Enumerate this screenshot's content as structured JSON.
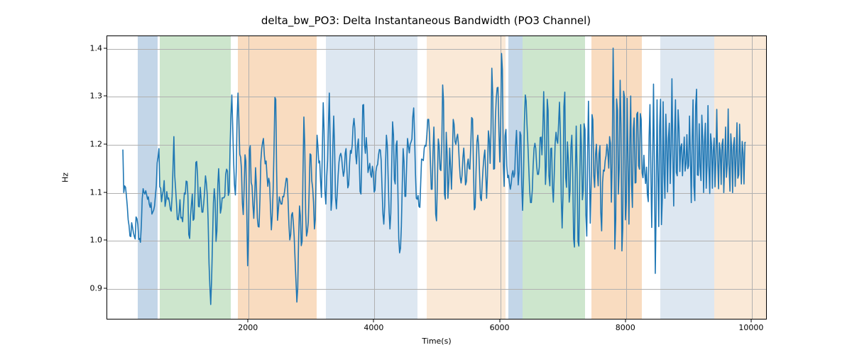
{
  "chart_data": {
    "type": "line",
    "title": "delta_bw_PO3: Delta Instantaneous Bandwidth (PO3 Channel)",
    "xlabel": "Time(s)",
    "ylabel": "Hz",
    "xlim": [
      -250,
      10250
    ],
    "ylim": [
      0.835,
      1.426
    ],
    "x_ticks": [
      2000,
      4000,
      6000,
      8000,
      10000
    ],
    "y_ticks": [
      0.9,
      1.0,
      1.1,
      1.2,
      1.3,
      1.4
    ],
    "bands": [
      {
        "start": 230,
        "end": 550,
        "color": "#c3d6e8"
      },
      {
        "start": 590,
        "end": 1710,
        "color": "#cde6cd"
      },
      {
        "start": 1830,
        "end": 3080,
        "color": "#f9dcc0"
      },
      {
        "start": 3230,
        "end": 4680,
        "color": "#dde7f1"
      },
      {
        "start": 4830,
        "end": 6080,
        "color": "#fae9d7"
      },
      {
        "start": 6130,
        "end": 6350,
        "color": "#c3d6e8"
      },
      {
        "start": 6350,
        "end": 7350,
        "color": "#cde6cd"
      },
      {
        "start": 7450,
        "end": 8250,
        "color": "#f9dcc0"
      },
      {
        "start": 8550,
        "end": 9400,
        "color": "#dde7f1"
      },
      {
        "start": 9400,
        "end": 10250,
        "color": "#fae9d7"
      }
    ],
    "series": [
      {
        "name": "delta_bw_PO3",
        "color": "#1f77b4",
        "x_start": 0,
        "x_step": 14,
        "values": [
          1.189,
          1.099,
          1.113,
          1.11,
          1.092,
          1.071,
          1.042,
          1.03,
          1.008,
          1.007,
          1.036,
          1.026,
          1.015,
          1.007,
          1.002,
          1.048,
          1.044,
          1.032,
          1.001,
          1.003,
          0.995,
          1.031,
          1.086,
          1.107,
          1.099,
          1.096,
          1.103,
          1.095,
          1.085,
          1.09,
          1.075,
          1.068,
          1.078,
          1.054,
          1.058,
          1.062,
          1.071,
          1.092,
          1.114,
          1.161,
          1.173,
          1.191,
          1.111,
          1.108,
          1.08,
          1.094,
          1.103,
          1.124,
          1.07,
          1.082,
          1.101,
          1.085,
          1.088,
          1.078,
          1.064,
          1.06,
          1.091,
          1.149,
          1.216,
          1.134,
          1.108,
          1.076,
          1.043,
          1.042,
          1.057,
          1.084,
          1.046,
          1.047,
          1.038,
          1.071,
          1.098,
          1.096,
          1.123,
          1.122,
          1.093,
          1.011,
          1.003,
          1.05,
          1.075,
          1.096,
          1.041,
          1.044,
          1.097,
          1.162,
          1.164,
          1.135,
          1.07,
          1.069,
          1.11,
          1.086,
          1.058,
          1.058,
          1.076,
          1.103,
          1.134,
          1.12,
          1.094,
          1.042,
          0.951,
          0.903,
          0.865,
          0.919,
          0.996,
          1.077,
          1.107,
          1.083,
          0.997,
          1.018,
          1.115,
          1.149,
          1.107,
          1.056,
          1.066,
          1.088,
          1.088,
          1.088,
          1.092,
          1.137,
          1.148,
          1.144,
          1.093,
          1.1,
          1.191,
          1.262,
          1.303,
          1.239,
          1.166,
          1.116,
          1.094,
          1.143,
          1.252,
          1.307,
          1.252,
          1.179,
          1.173,
          1.148,
          1.077,
          1.053,
          1.11,
          1.178,
          1.165,
          1.06,
          0.946,
          1.016,
          1.188,
          1.197,
          1.12,
          1.113,
          1.072,
          1.045,
          1.088,
          1.151,
          1.112,
          1.046,
          1.028,
          1.027,
          1.086,
          1.164,
          1.191,
          1.204,
          1.212,
          1.177,
          1.159,
          1.165,
          1.135,
          1.112,
          1.129,
          1.119,
          1.065,
          1.021,
          1.05,
          1.105,
          1.186,
          1.298,
          1.294,
          1.147,
          1.041,
          1.064,
          1.09,
          1.082,
          1.075,
          1.075,
          1.091,
          1.09,
          1.101,
          1.115,
          1.129,
          1.128,
          1.082,
          1.032,
          1.0,
          1.011,
          1.052,
          1.057,
          1.036,
          1.007,
          0.957,
          0.915,
          0.87,
          0.899,
          0.997,
          1.071,
          1.051,
          0.988,
          0.997,
          1.137,
          1.257,
          1.199,
          1.056,
          1.008,
          1.017,
          1.037,
          1.1,
          1.18,
          1.178,
          1.124,
          1.108,
          1.079,
          1.023,
          1.043,
          1.144,
          1.219,
          1.196,
          1.161,
          1.165,
          1.124,
          1.089,
          1.184,
          1.287,
          1.229,
          1.102,
          1.075,
          1.132,
          1.166,
          1.243,
          1.307,
          1.193,
          1.062,
          1.086,
          1.198,
          1.259,
          1.189,
          1.089,
          1.065,
          1.099,
          1.134,
          1.163,
          1.176,
          1.181,
          1.172,
          1.15,
          1.133,
          1.144,
          1.181,
          1.191,
          1.149,
          1.109,
          1.115,
          1.16,
          1.187,
          1.181,
          1.198,
          1.237,
          1.254,
          1.233,
          1.178,
          1.159,
          1.196,
          1.211,
          1.165,
          1.101,
          1.096,
          1.179,
          1.282,
          1.283,
          1.201,
          1.181,
          1.214,
          1.188,
          1.141,
          1.15,
          1.16,
          1.137,
          1.131,
          1.154,
          1.142,
          1.1,
          1.104,
          1.143,
          1.154,
          1.158,
          1.178,
          1.189,
          1.188,
          1.166,
          1.109,
          1.054,
          1.033,
          1.072,
          1.16,
          1.219,
          1.197,
          1.127,
          1.058,
          1.023,
          1.056,
          1.158,
          1.247,
          1.219,
          1.126,
          1.117,
          1.198,
          1.207,
          1.103,
          1.003,
          0.973,
          0.983,
          1.028,
          1.117,
          1.191,
          1.164,
          1.091,
          1.091,
          1.159,
          1.212,
          1.197,
          1.182,
          1.2,
          1.205,
          1.211,
          1.257,
          1.276,
          1.22,
          1.139,
          1.087,
          1.085,
          1.093,
          1.07,
          1.068,
          1.119,
          1.169,
          1.168,
          1.166,
          1.192,
          1.198,
          1.196,
          1.22,
          1.252,
          1.252,
          1.222,
          1.167,
          1.106,
          1.106,
          1.186,
          1.236,
          1.164,
          1.054,
          1.04,
          1.126,
          1.211,
          1.197,
          1.148,
          1.145,
          1.205,
          1.324,
          1.291,
          1.096,
          1.085,
          1.225,
          1.184,
          1.087,
          1.123,
          1.192,
          1.151,
          1.106,
          1.165,
          1.252,
          1.242,
          1.206,
          1.2,
          1.213,
          1.221,
          1.199,
          1.159,
          1.131,
          1.119,
          1.135,
          1.171,
          1.192,
          1.159,
          1.115,
          1.122,
          1.157,
          1.169,
          1.15,
          1.148,
          1.199,
          1.256,
          1.253,
          1.157,
          1.063,
          1.068,
          1.143,
          1.206,
          1.219,
          1.194,
          1.137,
          1.088,
          1.082,
          1.118,
          1.149,
          1.174,
          1.188,
          1.139,
          1.087,
          1.134,
          1.228,
          1.211,
          1.16,
          1.228,
          1.359,
          1.301,
          1.148,
          1.149,
          1.251,
          1.295,
          1.318,
          1.319,
          1.227,
          1.163,
          1.238,
          1.39,
          1.356,
          1.159,
          1.112,
          1.218,
          1.231,
          1.155,
          1.13,
          1.135,
          1.119,
          1.106,
          1.117,
          1.138,
          1.145,
          1.131,
          1.139,
          1.195,
          1.229,
          1.178,
          1.115,
          1.143,
          1.226,
          1.219,
          1.115,
          1.062,
          1.131,
          1.243,
          1.303,
          1.291,
          1.242,
          1.199,
          1.152,
          1.103,
          1.078,
          1.078,
          1.104,
          1.155,
          1.192,
          1.202,
          1.191,
          1.154,
          1.137,
          1.137,
          1.153,
          1.214,
          1.215,
          1.178,
          1.232,
          1.31,
          1.236,
          1.116,
          1.155,
          1.294,
          1.271,
          1.134,
          1.113,
          1.191,
          1.192,
          1.11,
          1.079,
          1.136,
          1.201,
          1.225,
          1.208,
          1.202,
          1.246,
          1.288,
          1.217,
          1.088,
          1.025,
          1.095,
          1.279,
          1.309,
          1.13,
          1.11,
          1.205,
          1.169,
          1.079,
          1.103,
          1.193,
          1.219,
          1.145,
          1.003,
          0.985,
          1.131,
          1.238,
          1.145,
          0.997,
          0.987,
          1.119,
          1.241,
          1.192,
          1.084,
          1.103,
          1.243,
          1.231,
          1.052,
          1.008,
          1.181,
          1.29,
          1.151,
          1.035,
          1.119,
          1.262,
          1.251,
          1.134,
          1.11,
          1.179,
          1.2,
          1.146,
          1.113,
          1.18,
          1.197,
          1.057,
          1.019,
          1.12,
          1.146,
          1.144,
          1.166,
          1.176,
          1.2,
          1.185,
          1.15,
          1.216,
          1.202,
          1.079,
          1.161,
          1.401,
          1.265,
          0.981,
          1.043,
          1.295,
          1.271,
          1.096,
          1.148,
          1.334,
          1.241,
          0.977,
          1.024,
          1.311,
          1.298,
          1.042,
          1.079,
          1.296,
          1.171,
          1.033,
          1.197,
          1.301,
          1.116,
          1.068,
          1.232,
          1.255,
          1.119,
          1.12,
          1.263,
          1.267,
          1.155,
          1.148,
          1.264,
          1.252,
          1.14,
          1.13,
          1.177,
          1.14,
          1.118,
          1.152,
          1.096,
          1.08,
          1.216,
          1.283,
          1.14,
          1.026,
          1.164,
          1.326,
          1.164,
          0.93,
          1.066,
          1.293,
          1.144,
          1.028,
          1.237,
          1.294,
          1.032,
          1.083,
          1.289,
          1.138,
          1.087,
          1.263,
          1.204,
          1.1,
          1.213,
          1.244,
          1.118,
          1.189,
          1.337,
          1.177,
          1.071,
          1.226,
          1.293,
          1.141,
          1.134,
          1.272,
          1.233,
          1.143,
          1.194,
          1.201,
          1.134,
          1.178,
          1.215,
          1.144,
          1.16,
          1.22,
          1.149,
          1.155,
          1.259,
          1.176,
          1.078,
          1.211,
          1.293,
          1.113,
          1.082,
          1.281,
          1.315,
          1.136,
          1.135,
          1.243,
          1.153,
          1.124,
          1.261,
          1.216,
          1.099,
          1.204,
          1.244,
          1.108,
          1.158,
          1.281,
          1.154,
          1.097,
          1.222,
          1.201,
          1.108,
          1.186,
          1.213,
          1.111,
          1.166,
          1.273,
          1.168,
          1.107,
          1.203,
          1.188,
          1.116,
          1.2,
          1.211,
          1.099,
          1.154,
          1.236,
          1.131,
          1.159,
          1.274,
          1.155,
          1.102,
          1.222,
          1.187,
          1.099,
          1.197,
          1.214,
          1.112,
          1.174,
          1.245,
          1.129,
          1.136,
          1.242,
          1.165,
          1.117,
          1.206,
          1.181,
          1.117,
          1.204,
          1.204
        ]
      }
    ]
  }
}
